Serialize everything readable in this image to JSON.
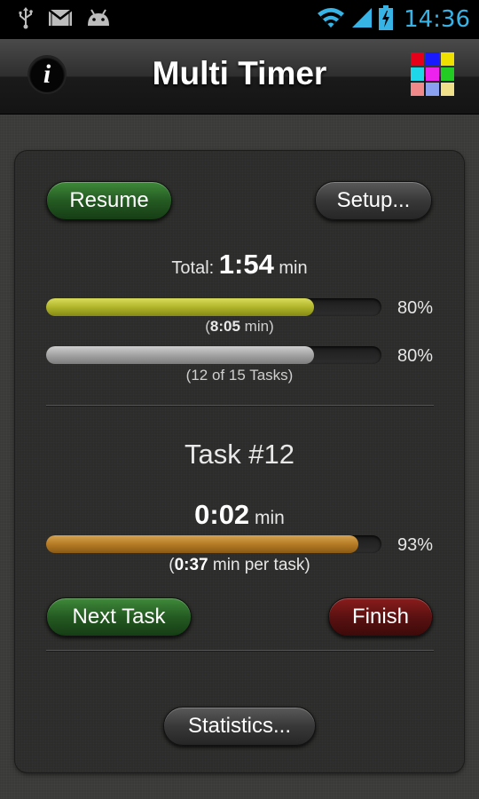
{
  "status_bar": {
    "time": "14:36",
    "icons": [
      "usb-icon",
      "gmail-icon",
      "android-icon",
      "wifi-icon",
      "signal-icon",
      "battery-charging-icon"
    ]
  },
  "title_bar": {
    "title": "Multi Timer",
    "info_label": "i"
  },
  "controls": {
    "resume_label": "Resume",
    "setup_label": "Setup..."
  },
  "total": {
    "prefix": "Total:",
    "value": "1:54",
    "unit": "min"
  },
  "progress_time": {
    "fraction": 0.8,
    "percent_text": "80%",
    "open": "(",
    "value": "8:05",
    "rest": " min)"
  },
  "progress_tasks": {
    "fraction": 0.8,
    "percent_text": "80%",
    "label": "(12 of 15 Tasks)"
  },
  "task": {
    "title": "Task #12",
    "value": "0:02",
    "unit": "min",
    "fraction": 0.93,
    "percent_text": "93%",
    "open": "(",
    "per_task_value": "0:37",
    "per_task_rest": " min per task)"
  },
  "actions": {
    "next_label": "Next Task",
    "finish_label": "Finish",
    "statistics_label": "Statistics..."
  },
  "colors": {
    "status_time": "#38b3e6",
    "green_button": "#245a22",
    "red_button": "#5a1111",
    "bar_total": "#b0b52a",
    "bar_tasks": "#a3a3a3",
    "bar_task": "#b57b25"
  }
}
